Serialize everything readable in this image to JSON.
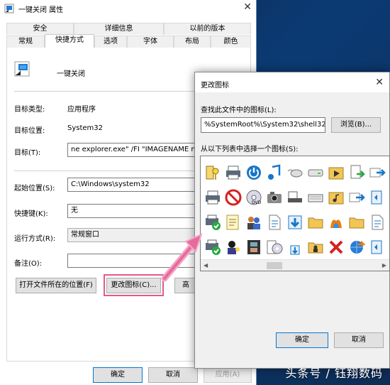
{
  "props_window": {
    "title": "一键关闭 属性",
    "tabs_row1": [
      "安全",
      "详细信息",
      "以前的版本"
    ],
    "tabs_row2": [
      "常规",
      "快捷方式",
      "选项",
      "字体",
      "布局",
      "颜色"
    ],
    "shortcut_name": "一键关闭",
    "target_type_label": "目标类型:",
    "target_type_value": "应用程序",
    "target_location_label": "目标位置:",
    "target_location_value": "System32",
    "target_label": "目标(T):",
    "target_value": "ne explorer.exe\" /FI \"IMAGENAME ne",
    "start_in_label": "起始位置(S):",
    "start_in_value": "C:\\Windows\\system32",
    "hotkey_label": "快捷键(K):",
    "hotkey_value": "无",
    "run_label": "运行方式(R):",
    "run_value": "常规窗口",
    "comment_label": "备注(O):",
    "comment_value": "",
    "open_location_button": "打开文件所在的位置(F)",
    "change_icon_button": "更改图标(C)...",
    "advanced_button": "高",
    "ok_button": "确定",
    "cancel_button": "取消",
    "apply_button": "应用(A)"
  },
  "icon_dialog": {
    "title": "更改图标",
    "find_label": "查找此文件中的图标(L):",
    "path_value": "%SystemRoot%\\System32\\shell32.d",
    "browse_button": "浏览(B)...",
    "select_label": "从以下列表中选择一个图标(S):",
    "ok_button": "确定",
    "cancel_button": "取消",
    "icons": [
      "key-icon",
      "printer-icon",
      "power-icon",
      "music-note-icon",
      "mouse-icon",
      "hard-drive-icon",
      "media-folder-icon",
      "document-arrow-icon",
      "arrow-right-icon",
      "printer-icon",
      "no-sign-icon",
      "dvd-icon",
      "camera-icon",
      "scanner-icon",
      "keyboard-icon",
      "folder-music-icon",
      "arrow-right-icon",
      "window-icon",
      "printer-check-icon",
      "notes-icon",
      "users-icon",
      "document-icon",
      "download-icon",
      "folder-icon",
      "msn-icon",
      "folder-icon",
      "document-icon",
      "printer-check-icon",
      "user-key-icon",
      "film-icon",
      "cd-list-icon",
      "small-download-icon",
      "folder-person-icon",
      "red-x-icon",
      "network-icon",
      "window-icon"
    ]
  },
  "watermark": "头条号 / 钰翔数码"
}
